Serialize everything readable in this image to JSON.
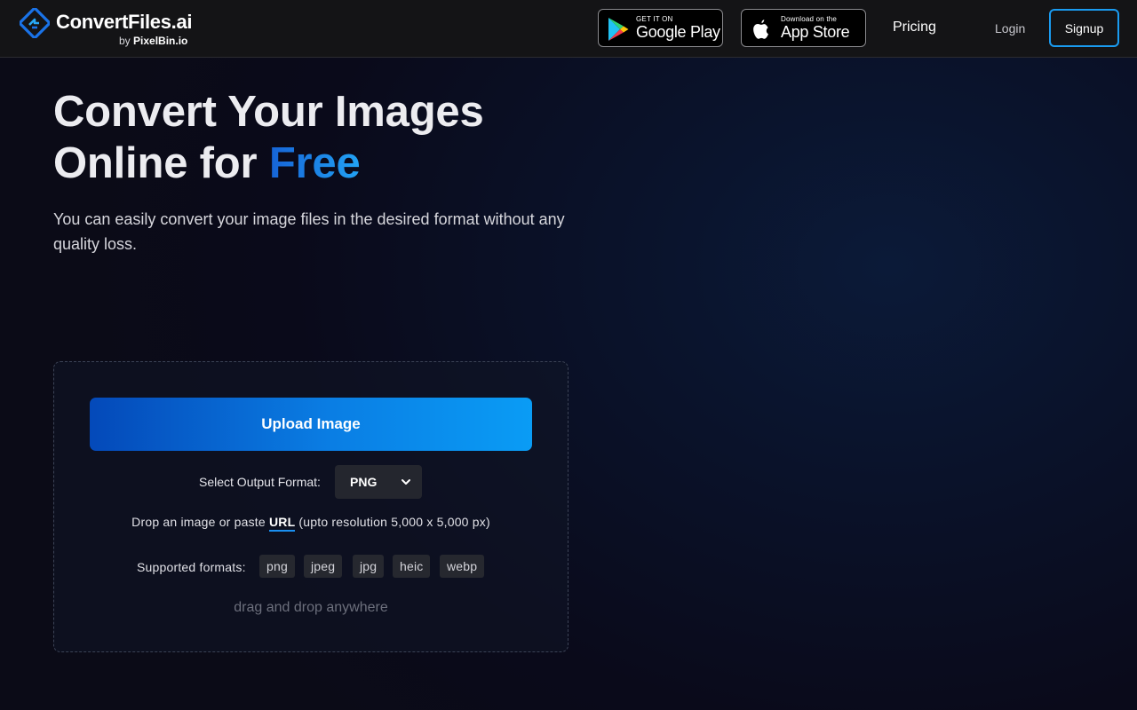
{
  "header": {
    "logo": {
      "name_main": "ConvertFiles",
      "name_suffix": ".ai",
      "sub_prefix": "by ",
      "sub_brand": "PixelBin.io",
      "icon": "convertfiles-logo-icon"
    },
    "google_play": {
      "small": "GET IT ON",
      "big": "Google Play",
      "icon": "google-play-icon"
    },
    "app_store": {
      "small": "Download on the",
      "big": "App Store",
      "icon": "apple-icon"
    },
    "pricing": "Pricing",
    "login": "Login",
    "signup": "Signup"
  },
  "hero": {
    "title_line1": "Convert Your Images",
    "title_line2_prefix": "Online for ",
    "title_accent": "Free",
    "subtitle": "You can easily convert your image files in the desired format without any quality loss."
  },
  "upload": {
    "button": "Upload Image",
    "format_label": "Select Output Format:",
    "format_value": "PNG",
    "drop_prefix": "Drop an image or paste ",
    "drop_link": "URL",
    "drop_suffix": " (upto resolution 5,000 x 5,000 px)",
    "supported_label": "Supported formats:",
    "formats": [
      "png",
      "jpeg",
      "jpg",
      "heic",
      "webp"
    ],
    "drag_hint": "drag and drop anywhere"
  },
  "colors": {
    "accent_blue": "#1a9bf0",
    "upload_gradient_start": "#0449b9",
    "upload_gradient_end": "#0a9cf5",
    "background": "#0b0b17",
    "header_bg": "#141416"
  }
}
